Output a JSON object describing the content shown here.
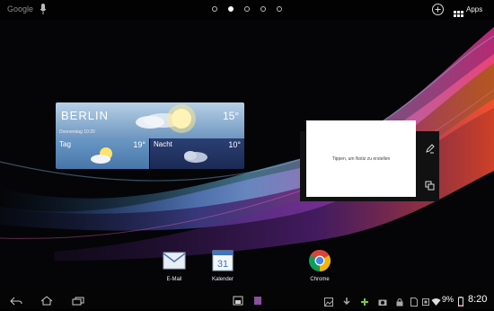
{
  "topbar": {
    "search_label": "Google",
    "search_icon": "mic-icon",
    "add_icon": "add-circle-icon",
    "apps_icon": "apps-grid-icon",
    "apps_label": "Apps"
  },
  "pages": {
    "count": 5,
    "current": 2
  },
  "weather": {
    "city": "BERLIN",
    "date": "Donnerstag 10:20",
    "temp_now": "15°",
    "day_label": "Tag",
    "day_temp": "19°",
    "night_label": "Nacht",
    "night_temp": "10°"
  },
  "note": {
    "placeholder": "Tippen, um Notiz zu erstellen",
    "edit_icon": "pencil-icon",
    "copy_icon": "copy-icon"
  },
  "dock": [
    {
      "label": "E-Mail",
      "icon": "email-icon"
    },
    {
      "label": "Kalender",
      "icon": "calendar-icon",
      "badge": "31"
    },
    {
      "label": "Chrome",
      "icon": "chrome-icon"
    }
  ],
  "navbar": {
    "back_icon": "back-icon",
    "home_icon": "home-icon",
    "recents_icon": "recents-icon",
    "status_icons": [
      "image-icon",
      "download-icon",
      "plus-icon",
      "camera-icon",
      "lock-icon",
      "sim-icon",
      "wifi-icon",
      "battery-icon"
    ],
    "battery": "9%",
    "time": "8:20"
  },
  "colors": {
    "accent_blue": "#5a88bb",
    "chrome_red": "#db4437",
    "chrome_yellow": "#f4b400",
    "chrome_green": "#0f9d58"
  }
}
